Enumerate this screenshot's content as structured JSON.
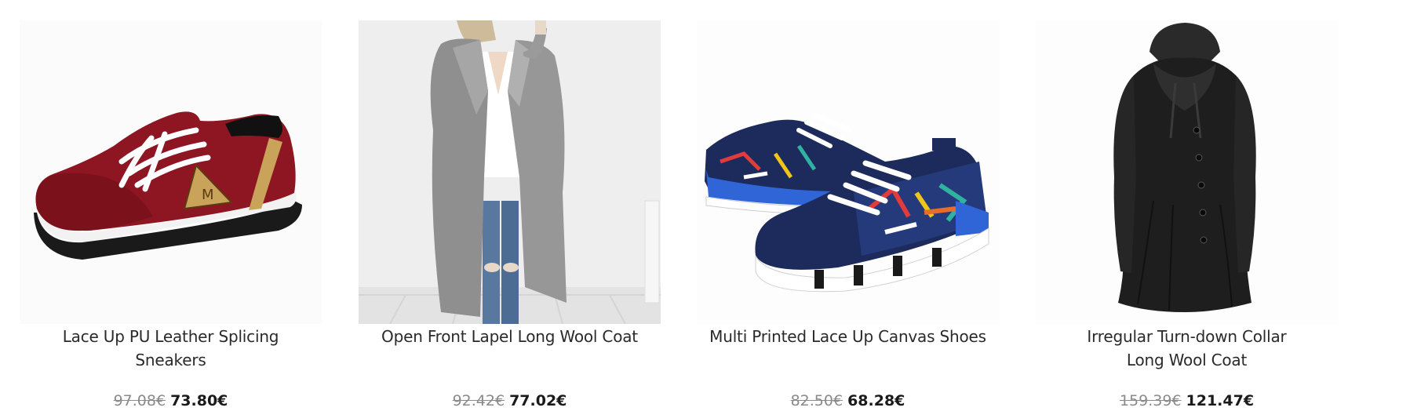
{
  "products": [
    {
      "title": "Lace Up PU Leather Splicing Sneakers",
      "old_price": "97.08€",
      "new_price": "73.80€",
      "image": "burgundy-suede-sneaker"
    },
    {
      "title": "Open Front Lapel Long Wool Coat",
      "old_price": "92.42€",
      "new_price": "77.02€",
      "image": "grey-long-wool-coat"
    },
    {
      "title": "Multi Printed Lace Up Canvas Shoes",
      "old_price": "82.50€",
      "new_price": "68.28€",
      "image": "printed-canvas-shoes"
    },
    {
      "title": "Irregular Turn-down Collar Long Wool Coat",
      "old_price": "159.39€",
      "new_price": "121.47€",
      "image": "black-long-wool-coat"
    }
  ],
  "colors": {
    "old_price": "#8a8a8a",
    "new_price": "#1a1a1a",
    "title": "#2a2a2a"
  }
}
